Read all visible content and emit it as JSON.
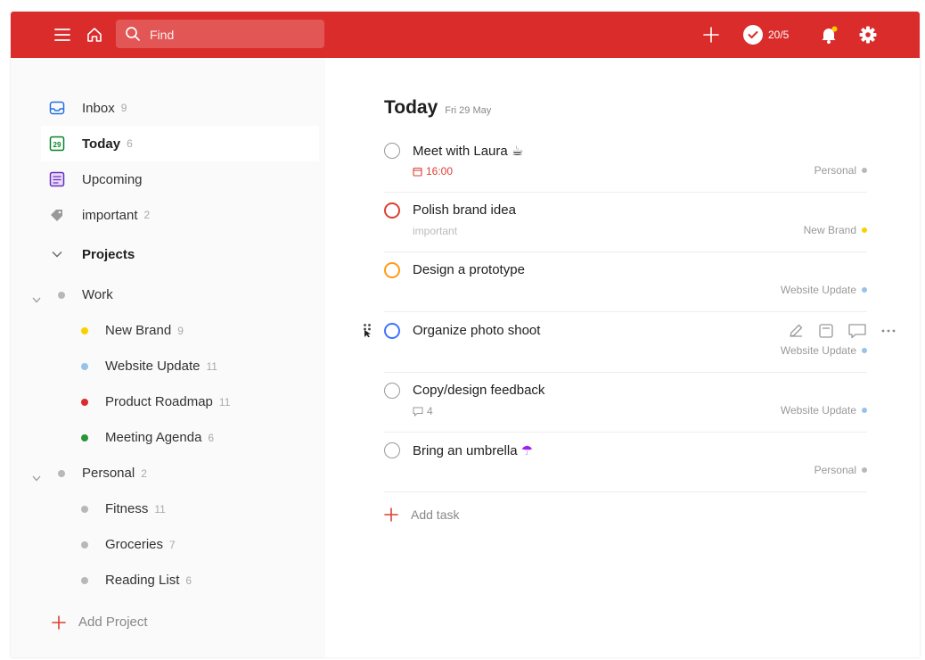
{
  "topbar": {
    "search_placeholder": "Find",
    "karma": "20/5"
  },
  "sidebar": {
    "nav": [
      {
        "label": "Inbox",
        "count": "9"
      },
      {
        "label": "Today",
        "count": "6"
      },
      {
        "label": "Upcoming",
        "count": ""
      },
      {
        "label": "important",
        "count": "2"
      }
    ],
    "projects_header": "Projects",
    "groups": [
      {
        "label": "Work",
        "count": "",
        "color": "#b8b8b8",
        "children": [
          {
            "label": "New Brand",
            "count": "9",
            "color": "#fad000"
          },
          {
            "label": "Website Update",
            "count": "11",
            "color": "#96c3eb"
          },
          {
            "label": "Product Roadmap",
            "count": "11",
            "color": "#db2c2c"
          },
          {
            "label": "Meeting Agenda",
            "count": "6",
            "color": "#299438"
          }
        ]
      },
      {
        "label": "Personal",
        "count": "2",
        "color": "#b8b8b8",
        "children": [
          {
            "label": "Fitness",
            "count": "11",
            "color": "#b8b8b8"
          },
          {
            "label": "Groceries",
            "count": "7",
            "color": "#b8b8b8"
          },
          {
            "label": "Reading List",
            "count": "6",
            "color": "#b8b8b8"
          }
        ]
      }
    ],
    "add_project": "Add Project"
  },
  "main": {
    "title": "Today",
    "date": "Fri 29 May",
    "tasks": [
      {
        "name": "Meet with Laura",
        "emoji": "☕",
        "sub": "16:00",
        "project": "Personal",
        "project_color": "#b8b8b8",
        "circle_color": "#999999"
      },
      {
        "name": "Polish brand idea",
        "emoji": "",
        "sub": "important",
        "project": "New Brand",
        "project_color": "#fad000",
        "circle_color": "#db4035"
      },
      {
        "name": "Design a prototype",
        "emoji": "",
        "sub": "",
        "project": "Website Update",
        "project_color": "#96c3eb",
        "circle_color": "#ff9a14"
      },
      {
        "name": "Organize photo shoot",
        "emoji": "",
        "sub": "",
        "project": "Website Update",
        "project_color": "#96c3eb",
        "circle_color": "#4073ff"
      },
      {
        "name": "Copy/design feedback",
        "emoji": "",
        "sub": "4",
        "project": "Website Update",
        "project_color": "#96c3eb",
        "circle_color": "#999999"
      },
      {
        "name": "Bring an umbrella",
        "emoji": "☂",
        "sub": "",
        "project": "Personal",
        "project_color": "#b8b8b8",
        "circle_color": "#999999"
      }
    ],
    "add_task": "Add task"
  },
  "colors": {
    "brand": "#db2c2c"
  }
}
